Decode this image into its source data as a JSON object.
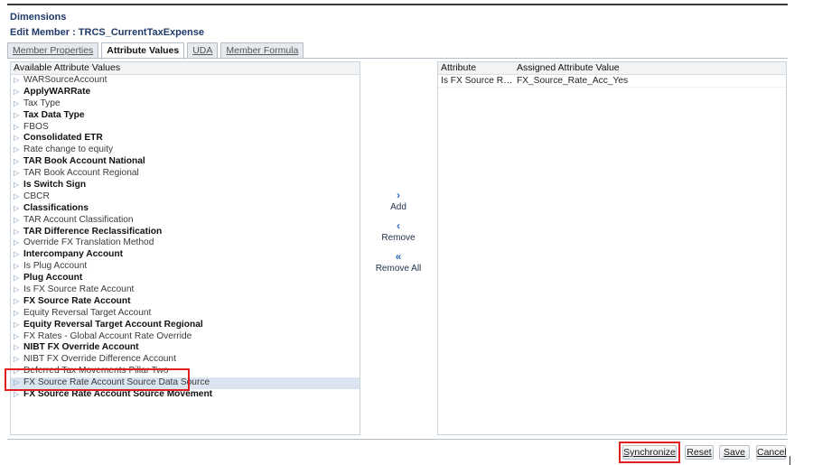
{
  "header": {
    "title": "Dimensions",
    "edit_member": "Edit Member : TRCS_CurrentTaxExpense"
  },
  "tabs": [
    {
      "label": "Member Properties",
      "active": false
    },
    {
      "label": "Attribute Values",
      "active": true
    },
    {
      "label": "UDA",
      "active": false
    },
    {
      "label": "Member Formula",
      "active": false
    }
  ],
  "available": {
    "header": "Available Attribute Values",
    "items": [
      {
        "label": "WARSourceAccount",
        "bold": false
      },
      {
        "label": "ApplyWARRate",
        "bold": true
      },
      {
        "label": "Tax Type",
        "bold": false
      },
      {
        "label": "Tax Data Type",
        "bold": true
      },
      {
        "label": "FBOS",
        "bold": false
      },
      {
        "label": "Consolidated ETR",
        "bold": true
      },
      {
        "label": "Rate change to equity",
        "bold": false
      },
      {
        "label": "TAR Book Account National",
        "bold": true
      },
      {
        "label": "TAR Book Account Regional",
        "bold": false
      },
      {
        "label": "Is Switch Sign",
        "bold": true
      },
      {
        "label": "CBCR",
        "bold": false
      },
      {
        "label": "Classifications",
        "bold": true
      },
      {
        "label": "TAR Account Classification",
        "bold": false
      },
      {
        "label": "TAR Difference Reclassification",
        "bold": true
      },
      {
        "label": "Override FX Translation Method",
        "bold": false
      },
      {
        "label": "Intercompany Account",
        "bold": true
      },
      {
        "label": "Is Plug Account",
        "bold": false
      },
      {
        "label": "Plug Account",
        "bold": true
      },
      {
        "label": "Is FX Source Rate Account",
        "bold": false
      },
      {
        "label": "FX Source Rate Account",
        "bold": true
      },
      {
        "label": "Equity Reversal Target Account",
        "bold": false
      },
      {
        "label": "Equity Reversal Target Account Regional",
        "bold": true
      },
      {
        "label": "FX Rates - Global Account Rate Override",
        "bold": false
      },
      {
        "label": "NIBT FX Override Account",
        "bold": true
      },
      {
        "label": "NIBT FX Override Difference Account",
        "bold": false
      },
      {
        "label": "Deferred Tax Movements Pillar Two",
        "bold": false
      },
      {
        "label": "FX Source Rate Account Source Data Source",
        "bold": false,
        "selected": true
      },
      {
        "label": "FX Source Rate Account Source Movement",
        "bold": true
      }
    ]
  },
  "assigned": {
    "col_attribute": "Attribute",
    "col_value": "Assigned Attribute Value",
    "rows": [
      {
        "attribute": "Is FX Source Rate ...",
        "value": "FX_Source_Rate_Acc_Yes"
      }
    ]
  },
  "shuttle": {
    "add": "Add",
    "remove": "Remove",
    "remove_all": "Remove All"
  },
  "buttons": {
    "synchronize": "Synchronize",
    "reset": "Reset",
    "save": "Save",
    "cancel": "Cancel"
  },
  "colors": {
    "title": "#1f3a6b",
    "selected_row": "#dbe5f1",
    "highlight_box": "#e02020",
    "shuttle_icon": "#2e6fc0"
  }
}
